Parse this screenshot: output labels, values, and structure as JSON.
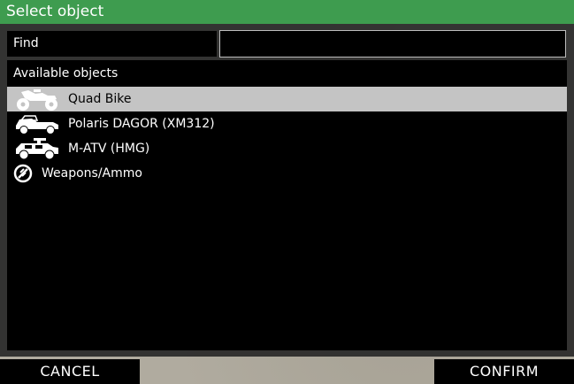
{
  "dialog": {
    "title": "Select object"
  },
  "search": {
    "label": "Find",
    "value": ""
  },
  "list": {
    "header": "Available objects",
    "items": [
      {
        "label": "Quad Bike",
        "icon": "quad-bike-icon",
        "selected": true
      },
      {
        "label": "Polaris DAGOR (XM312)",
        "icon": "car-icon",
        "selected": false
      },
      {
        "label": "M-ATV (HMG)",
        "icon": "armored-truck-icon",
        "selected": false
      },
      {
        "label": "Weapons/Ammo",
        "icon": "weapons-ammo-icon",
        "selected": false
      }
    ]
  },
  "buttons": {
    "cancel": "CANCEL",
    "confirm": "CONFIRM"
  },
  "colors": {
    "titlebar": "#3e9c4f",
    "selected_row": "#c4c4c4"
  }
}
